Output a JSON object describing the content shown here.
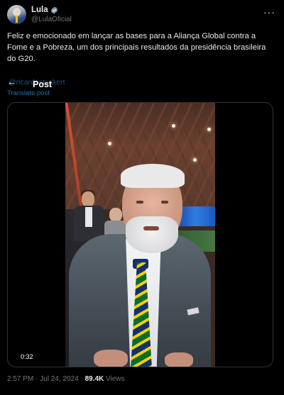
{
  "header": {
    "display_name": "Lula",
    "handle": "@LulaOficial",
    "more_icon": "more-horizontal-icon"
  },
  "tweet": {
    "text": "Feliz e emocionado em lançar as bases para a Aliança Global contra a Fome e a Pobreza, um dos principais resultados da presidência brasileira do G20.",
    "credit": "@ricardostuckert",
    "translate_label": "Translate post"
  },
  "overlay": {
    "back_icon": "arrow-left-icon",
    "title": "Post"
  },
  "media": {
    "duration": "0:32"
  },
  "footer": {
    "time": "2:57 PM",
    "date": "Jul 24, 2024",
    "views_count": "89.4K",
    "views_label": "Views",
    "separator": "·"
  },
  "colors": {
    "background": "#000000",
    "text": "#e7e9ea",
    "muted": "#71767b",
    "link": "#1d9bf0"
  }
}
